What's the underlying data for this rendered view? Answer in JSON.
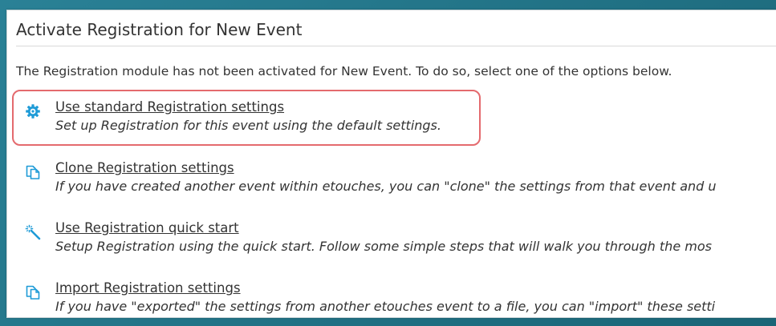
{
  "panel": {
    "title": "Activate Registration for New Event",
    "intro": "The Registration module has not been activated for New Event. To do so, select one of the options below."
  },
  "options": [
    {
      "label": "Use standard Registration settings",
      "description": "Set up Registration for this event using the default settings.",
      "icon": "gear-icon"
    },
    {
      "label": "Clone Registration settings",
      "description": "If you have created another event within etouches, you can \"clone\" the settings from that event and u",
      "icon": "copy-icon"
    },
    {
      "label": "Use Registration quick start",
      "description": "Setup Registration using the quick start. Follow some simple steps that will walk you through the mos",
      "icon": "magic-wand-icon"
    },
    {
      "label": "Import Registration settings",
      "description": "If you have \"exported\" the settings from another etouches event to a file, you can \"import\" these setti",
      "icon": "copy-icon"
    }
  ],
  "colors": {
    "icon_blue": "#1e9bd7",
    "highlight": "#e46a6e",
    "background": "#1d6e80"
  }
}
